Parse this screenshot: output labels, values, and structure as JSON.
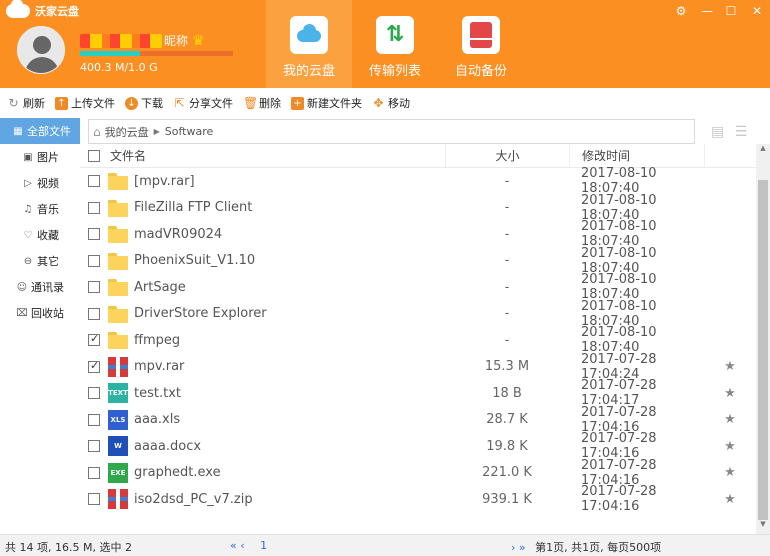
{
  "app": {
    "title": "沃家云盘"
  },
  "user": {
    "nickname": "昵称",
    "quota_text": "400.3 M/1.0 G",
    "quota_fraction": 0.39
  },
  "nav": [
    {
      "label": "我的云盘",
      "icon": "cloud-icon"
    },
    {
      "label": "传输列表",
      "icon": "transfer-icon"
    },
    {
      "label": "自动备份",
      "icon": "backup-icon"
    }
  ],
  "window_controls": {
    "settings": "⚙",
    "minimize": "—",
    "maximize": "☐",
    "close": "✕"
  },
  "toolbar": {
    "refresh": "刷新",
    "upload": "上传文件",
    "download": "下载",
    "share": "分享文件",
    "delete": "删除",
    "new_folder": "新建文件夹",
    "move": "移动"
  },
  "sidebar": [
    {
      "label": "全部文件",
      "icon": "grid-icon"
    },
    {
      "label": "图片",
      "icon": "image-icon"
    },
    {
      "label": "视频",
      "icon": "video-icon"
    },
    {
      "label": "音乐",
      "icon": "headphone-icon"
    },
    {
      "label": "收藏",
      "icon": "heart-icon"
    },
    {
      "label": "其它",
      "icon": "more-icon"
    },
    {
      "label": "通讯录",
      "icon": "contacts-icon"
    },
    {
      "label": "回收站",
      "icon": "trash-icon"
    }
  ],
  "breadcrumb": {
    "root": "我的云盘",
    "current": "Software"
  },
  "table": {
    "headers": {
      "name": "文件名",
      "size": "大小",
      "date": "修改时间"
    },
    "rows": [
      {
        "name": "[mpv.rar]",
        "size": "-",
        "date": "2017-08-10 18:07:40",
        "type": "folder",
        "checked": false,
        "fav": false
      },
      {
        "name": "FileZilla FTP Client",
        "size": "-",
        "date": "2017-08-10 18:07:40",
        "type": "folder",
        "checked": false,
        "fav": false
      },
      {
        "name": "madVR09024",
        "size": "-",
        "date": "2017-08-10 18:07:40",
        "type": "folder",
        "checked": false,
        "fav": false
      },
      {
        "name": "PhoenixSuit_V1.10",
        "size": "-",
        "date": "2017-08-10 18:07:40",
        "type": "folder",
        "checked": false,
        "fav": false
      },
      {
        "name": "ArtSage",
        "size": "-",
        "date": "2017-08-10 18:07:40",
        "type": "folder",
        "checked": false,
        "fav": false
      },
      {
        "name": "DriverStore Explorer",
        "size": "-",
        "date": "2017-08-10 18:07:40",
        "type": "folder",
        "checked": false,
        "fav": false
      },
      {
        "name": "ffmpeg",
        "size": "-",
        "date": "2017-08-10 18:07:40",
        "type": "folder",
        "checked": true,
        "fav": false
      },
      {
        "name": "mpv.rar",
        "size": "15.3 M",
        "date": "2017-07-28 17:04:24",
        "type": "rar",
        "checked": true,
        "fav": true
      },
      {
        "name": "test.txt",
        "size": "18 B",
        "date": "2017-07-28 17:04:17",
        "type": "txt",
        "checked": false,
        "fav": true
      },
      {
        "name": "aaa.xls",
        "size": "28.7 K",
        "date": "2017-07-28 17:04:16",
        "type": "xls",
        "checked": false,
        "fav": true
      },
      {
        "name": "aaaa.docx",
        "size": "19.8 K",
        "date": "2017-07-28 17:04:16",
        "type": "docx",
        "checked": false,
        "fav": true
      },
      {
        "name": "graphedt.exe",
        "size": "221.0 K",
        "date": "2017-07-28 17:04:16",
        "type": "exe",
        "checked": false,
        "fav": true
      },
      {
        "name": "iso2dsd_PC_v7.zip",
        "size": "939.1 K",
        "date": "2017-07-28 17:04:16",
        "type": "zip",
        "checked": false,
        "fav": true
      }
    ]
  },
  "file_types": {
    "rar": {
      "label": "",
      "color": "#d63a3a"
    },
    "zip": {
      "label": "",
      "color": "#d63a3a"
    },
    "txt": {
      "label": "TEXT",
      "color": "#2bb3a3"
    },
    "xls": {
      "label": "XLS",
      "color": "#2f5fd0"
    },
    "docx": {
      "label": "W",
      "color": "#1f4fb8"
    },
    "exe": {
      "label": "EXE",
      "color": "#2ea84a"
    }
  },
  "status": {
    "summary": "共 14 项, 16.5 M, 选中 2",
    "pager_prev": "« ‹",
    "page_current": "1",
    "pager_next": "› »",
    "page_info": "第1页, 共1页, 每页500项"
  }
}
